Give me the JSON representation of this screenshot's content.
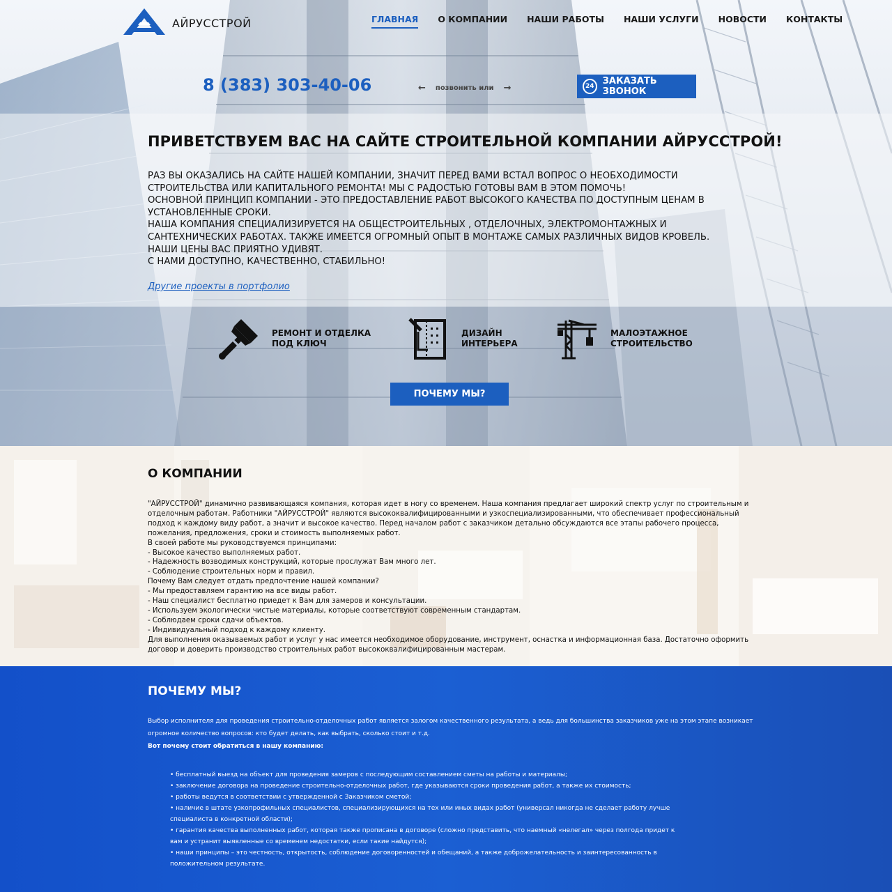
{
  "header": {
    "logo_text": "АЙРУССТРОЙ",
    "nav": [
      {
        "label": "ГЛАВНАЯ",
        "active": true
      },
      {
        "label": "О КОМПАНИИ",
        "active": false
      },
      {
        "label": "НАШИ РАБОТЫ",
        "active": false
      },
      {
        "label": "НАШИ УСЛУГИ",
        "active": false
      },
      {
        "label": "НОВОСТИ",
        "active": false
      },
      {
        "label": "КОНТАКТЫ",
        "active": false
      }
    ]
  },
  "call": {
    "phone": "8 (383) 303-40-06",
    "or_text": "позвонить или",
    "button_icon_text": "24",
    "button_label": "ЗАКАЗАТЬ ЗВОНОК"
  },
  "welcome": {
    "title": "ПРИВЕТСТВУЕМ ВАС НА САЙТЕ СТРОИТЕЛЬНОЙ КОМПАНИИ АЙРУССТРОЙ!",
    "lines": [
      "Раз вы оказались на сайте нашей компании, значит перед вами встал вопрос о необходимости строительства или капитального ремонта! Мы с радостью готовы вам в этом помочь!",
      "Основной принцип компании - это предоставление работ высокого качества по доступным ценам в установленные сроки.",
      "Наша компания специализируется на общестроительных , отделочных, электромонтажных и сантехнических работах. Также имеется огромный опыт в монтаже самых различных видов кровель.",
      "Наши цены вас приятно удивят.",
      "С нами доступно, качественно, стабильно!"
    ],
    "portfolio_link": "Другие проекты в портфолио"
  },
  "services": [
    {
      "label_line1": "РЕМОНТ И ОТДЕЛКА",
      "label_line2": "ПОД КЛЮЧ",
      "icon": "paint-brush-icon"
    },
    {
      "label_line1": "ДИЗАЙН",
      "label_line2": "ИНТЕРЬЕРА",
      "icon": "interior-design-icon"
    },
    {
      "label_line1": "МАЛОЭТАЖНОЕ",
      "label_line2": "СТРОИТЕЛЬСТВО",
      "icon": "crane-icon"
    }
  ],
  "why_button": "ПОЧЕМУ МЫ?",
  "about": {
    "title": "О КОМПАНИИ",
    "paragraphs": [
      "\"АЙРУССТРОЙ\" динамично развивающаяся компания, которая идет в ногу со временем. Наша компания предлагает широкий спектр услуг по строительным и отделочным работам. Работники \"АЙРУССТРОЙ\" являются высококвалифицированными и узкоспециализированными, что обеспечивает профессиональный подход к каждому виду работ, а значит и высокое качество. Перед началом работ с заказчиком детально обсуждаются все этапы рабочего процесса, пожелания, предложения, сроки и стоимость выполняемых работ.",
      "В своей работе мы руководствуемся принципами:",
      "- Высокое качество выполняемых работ.",
      "- Надежность возводимых конструкций, которые прослужат Вам много лет.",
      "- Соблюдение строительных норм и правил.",
      "Почему Вам следует отдать предпочтение нашей компании?",
      "- Мы предоставляем гарантию на все виды работ.",
      "- Наш специалист бесплатно приедет к Вам для замеров и консультации.",
      "- Используем экологически чистые материалы, которые соответствуют современным стандартам.",
      "- Соблюдаем сроки сдачи объектов.",
      "- Индивидуальный подход к каждому клиенту.",
      "Для выполнения оказываемых работ и услуг у нас имеется необходимое оборудование, инструмент, оснастка и информационная база. Достаточно оформить договор и доверить производство строительных работ высококвалифицированным мастерам."
    ]
  },
  "why": {
    "title": "ПОЧЕМУ МЫ?",
    "intro": "Выбор исполнителя для проведения строительно-отделочных работ является залогом качественного результата, а ведь для большинства заказчиков уже на этом этапе возникает огромное количество вопросов: кто будет делать, как выбрать, сколько стоит и т.д.",
    "intro_bold": "Вот почему стоит обратиться в нашу компанию:",
    "items": [
      "• бесплатный выезд на объект для проведения замеров с последующим составлением сметы на работы и материалы;",
      "• заключение договора на проведение строительно-отделочных работ, где указываются сроки проведения работ, а также их стоимость;",
      "• работы ведутся в соответствии с утвержденной с Заказчиком сметой;",
      "• наличие в штате узкопрофильных специалистов, специализирующихся на тех или иных видах работ (универсал никогда не сделает работу лучше специалиста в конкретной области);",
      "• гарантия качества выполненных работ, которая также прописана в договоре (сложно представить, что наемный «нелегал» через полгода придет к вам и устранит выявленные со временем недостатки, если такие найдутся);",
      "• наши принципы – это честность, открытость, соблюдение договоренностей и обещаний, а также доброжелательность и заинтересованность в положительном результате."
    ]
  },
  "colors": {
    "brand_blue": "#1c5fbf",
    "why_bg": "#1b5fd3"
  }
}
